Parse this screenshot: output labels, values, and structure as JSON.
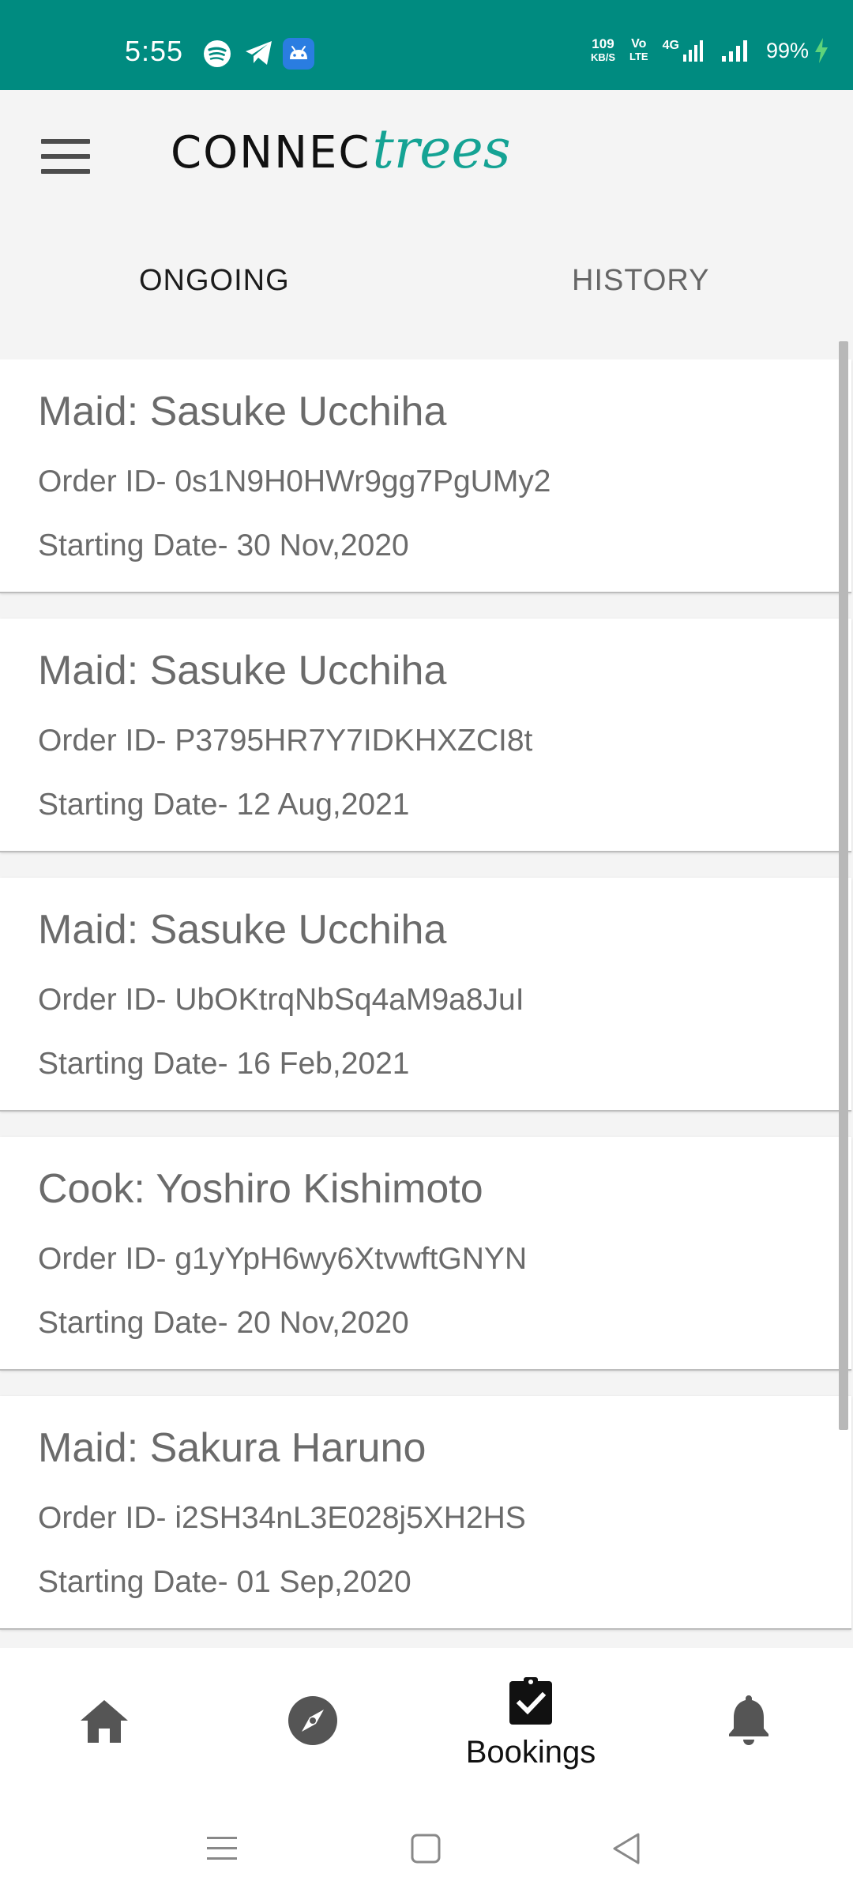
{
  "status_bar": {
    "time": "5:55",
    "net_speed_value": "109",
    "net_speed_unit": "KB/S",
    "volte_top": "Vo",
    "volte_bottom": "LTE",
    "network_type": "4G",
    "battery": "99%",
    "colors": {
      "background": "#008b80"
    },
    "icons": [
      "spotify-icon",
      "telegram-icon",
      "android-icon",
      "signal-icon",
      "battery-charging-icon"
    ]
  },
  "app_bar": {
    "logo_part1": "CONNEC",
    "logo_part2": "trees",
    "colors": {
      "logo_accent": "#15a394"
    }
  },
  "tabs": [
    {
      "label": "ONGOING",
      "selected": true
    },
    {
      "label": "HISTORY",
      "selected": false
    }
  ],
  "bookings": [
    {
      "title": "Maid: Sasuke Ucchiha",
      "order_id": "Order ID- 0s1N9H0HWr9gg7PgUMy2",
      "start_date": "Starting Date- 30 Nov,2020"
    },
    {
      "title": "Maid: Sasuke Ucchiha",
      "order_id": "Order ID- P3795HR7Y7IDKHXZCI8t",
      "start_date": "Starting Date- 12 Aug,2021"
    },
    {
      "title": "Maid: Sasuke Ucchiha",
      "order_id": "Order ID- UbOKtrqNbSq4aM9a8JuI",
      "start_date": "Starting Date- 16 Feb,2021"
    },
    {
      "title": "Cook: Yoshiro Kishimoto",
      "order_id": "Order ID- g1yYpH6wy6XtvwftGNYN",
      "start_date": "Starting Date- 20 Nov,2020"
    },
    {
      "title": "Maid: Sakura Haruno",
      "order_id": "Order ID- i2SH34nL3E028j5XH2HS",
      "start_date": "Starting Date- 01 Sep,2020"
    }
  ],
  "bottom_nav": {
    "items": [
      {
        "icon": "home-icon",
        "label": ""
      },
      {
        "icon": "compass-icon",
        "label": ""
      },
      {
        "icon": "bookings-clipboard-icon",
        "label": "Bookings",
        "selected": true
      },
      {
        "icon": "bell-icon",
        "label": ""
      }
    ]
  },
  "system_nav": {
    "icons": [
      "recents-icon",
      "home-square-icon",
      "back-icon"
    ]
  }
}
